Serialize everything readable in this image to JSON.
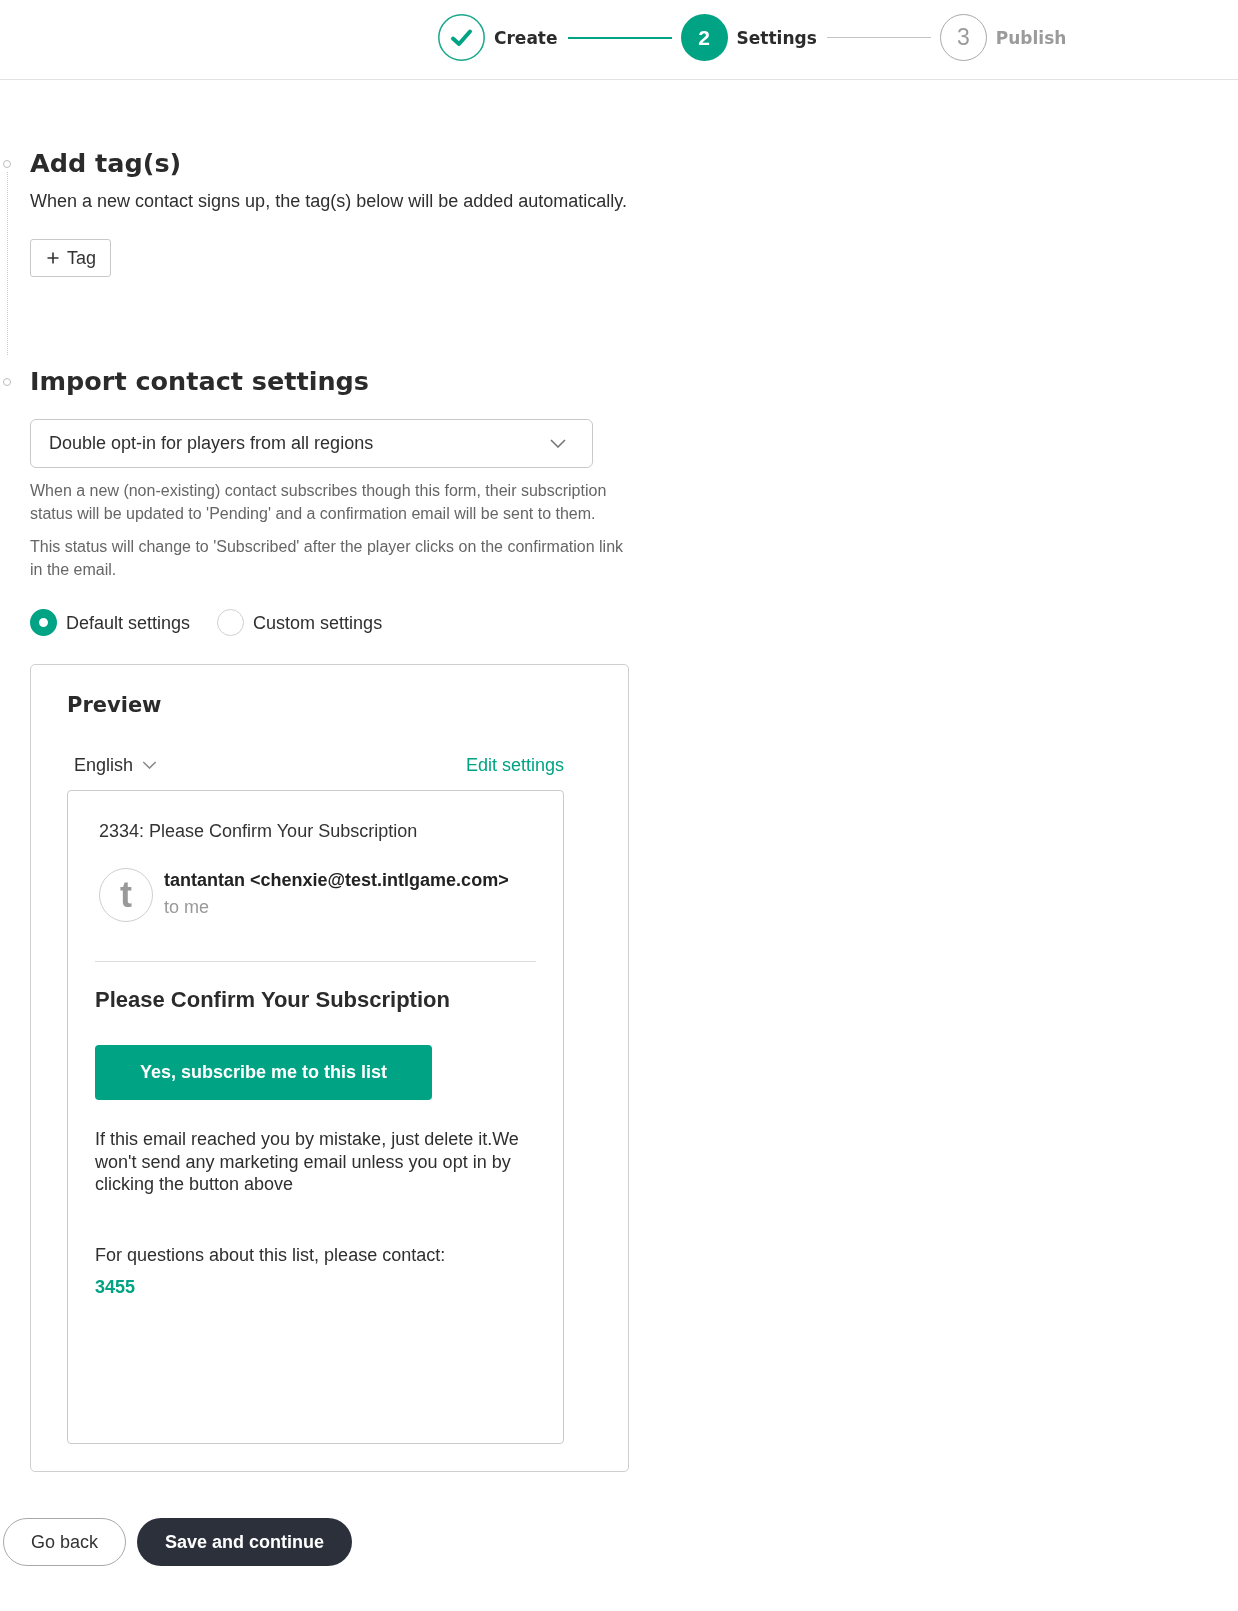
{
  "stepper": {
    "steps": [
      {
        "label": "Create",
        "done": true,
        "selected": false
      },
      {
        "number": "2",
        "label": "Settings",
        "done": false,
        "selected": true
      },
      {
        "number": "3",
        "label": "Publish",
        "done": false,
        "selected": false
      }
    ]
  },
  "add_tags": {
    "title": "Add tag(s)",
    "description": "When a new contact signs up, the tag(s) below will be added automatically.",
    "button": "Tag"
  },
  "import_settings": {
    "title": "Import contact settings",
    "dropdown": {
      "value": "Double opt-in for players from all regions"
    },
    "notes": [
      "When a new (non-existing) contact subscribes though this form, their subscription status will be updated to 'Pending' and a confirmation email will be sent to them.",
      "This status will change to 'Subscribed' after the player clicks on the confirmation link in the email."
    ],
    "options": [
      {
        "label": "Default settings",
        "selected": true
      },
      {
        "label": "Custom settings",
        "selected": false
      }
    ]
  },
  "preview": {
    "title": "Preview",
    "language": "English",
    "edit_link": "Edit settings",
    "email": {
      "subject": "2334: Please Confirm Your Subscription",
      "avatar_letter": "t",
      "sender": "tantantan <chenxie@test.intlgame.com>",
      "recipient": "to me",
      "heading": "Please Confirm Your Subscription",
      "button": "Yes, subscribe me to this list",
      "body": "If this email reached you by mistake, just delete it.We won't send any marketing email unless you opt in by clicking the button above",
      "contact_prompt": "For questions about this list, please contact:",
      "contact": "3455"
    }
  },
  "footer": {
    "buttons": [
      {
        "label": "Go back",
        "kind": "secondary"
      },
      {
        "label": "Save and continue",
        "kind": "primary"
      }
    ]
  }
}
